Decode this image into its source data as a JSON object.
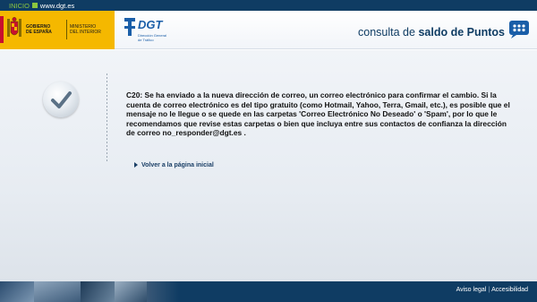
{
  "topbar": {
    "home_label": "INICIO",
    "url": "www.dgt.es"
  },
  "header": {
    "gov_label": "GOBIERNO\nDE ESPAÑA",
    "ministry_label": "MINISTERIO\nDEL INTERIOR",
    "dgt_name": "DGT",
    "dgt_sub": "Dirección General\nde Tráfico",
    "app_title_light": "consulta de",
    "app_title_bold": "saldo de Puntos",
    "brand_yellow": "#f5b800",
    "brand_blue": "#0f3c63"
  },
  "main": {
    "message": "C20: Se ha enviado a la nueva dirección de correo, un correo electrónico para confirmar el cambio. Si la cuenta de correo electrónico es del tipo gratuito (como Hotmail, Yahoo, Terra, Gmail, etc.), es posible que el mensaje no le llegue o se quede en las carpetas 'Correo Electrónico No Deseado' o 'Spam', por lo que le recomendamos que revise estas carpetas o bien que incluya entre sus contactos de confianza la dirección de correo no_responder@dgt.es .",
    "back_link": "Volver a la página inicial"
  },
  "footer": {
    "legal": "Aviso legal",
    "accessibility": "Accesibilidad"
  },
  "icons": {
    "check": "check-icon",
    "chat": "chat-bubble-icon",
    "shield": "coat-of-arms-icon",
    "arrow": "triangle-right-icon"
  }
}
